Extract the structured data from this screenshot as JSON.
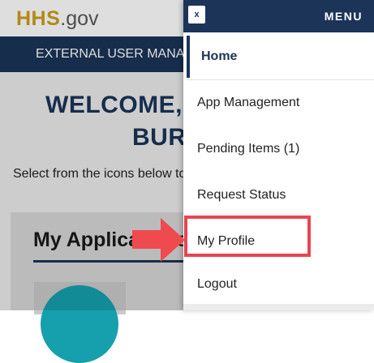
{
  "site": {
    "logo_primary": "HHS",
    "logo_secondary": ".gov",
    "banner_text": "EXTERNAL USER MANAGEMENT",
    "welcome_line1": "WELCOME,",
    "welcome_line2": "BUR",
    "intro_text": "Select from the icons below to access your applications.",
    "apps_section_title": "My Applications"
  },
  "menu": {
    "close_label": "x",
    "title": "MENU",
    "items": [
      {
        "label": "Home",
        "active": true
      },
      {
        "label": "App Management"
      },
      {
        "label": "Pending Items (1)"
      },
      {
        "label": "Request Status"
      },
      {
        "label": "My Profile",
        "highlighted": true
      },
      {
        "label": "Logout"
      }
    ]
  },
  "colors": {
    "navy": "#1b3458",
    "gold": "#cc9e1a",
    "highlight": "#e94452",
    "app_icon": "#16a0ad"
  },
  "annotation": {
    "arrow_icon": "right-arrow-icon",
    "target": "My Profile"
  }
}
